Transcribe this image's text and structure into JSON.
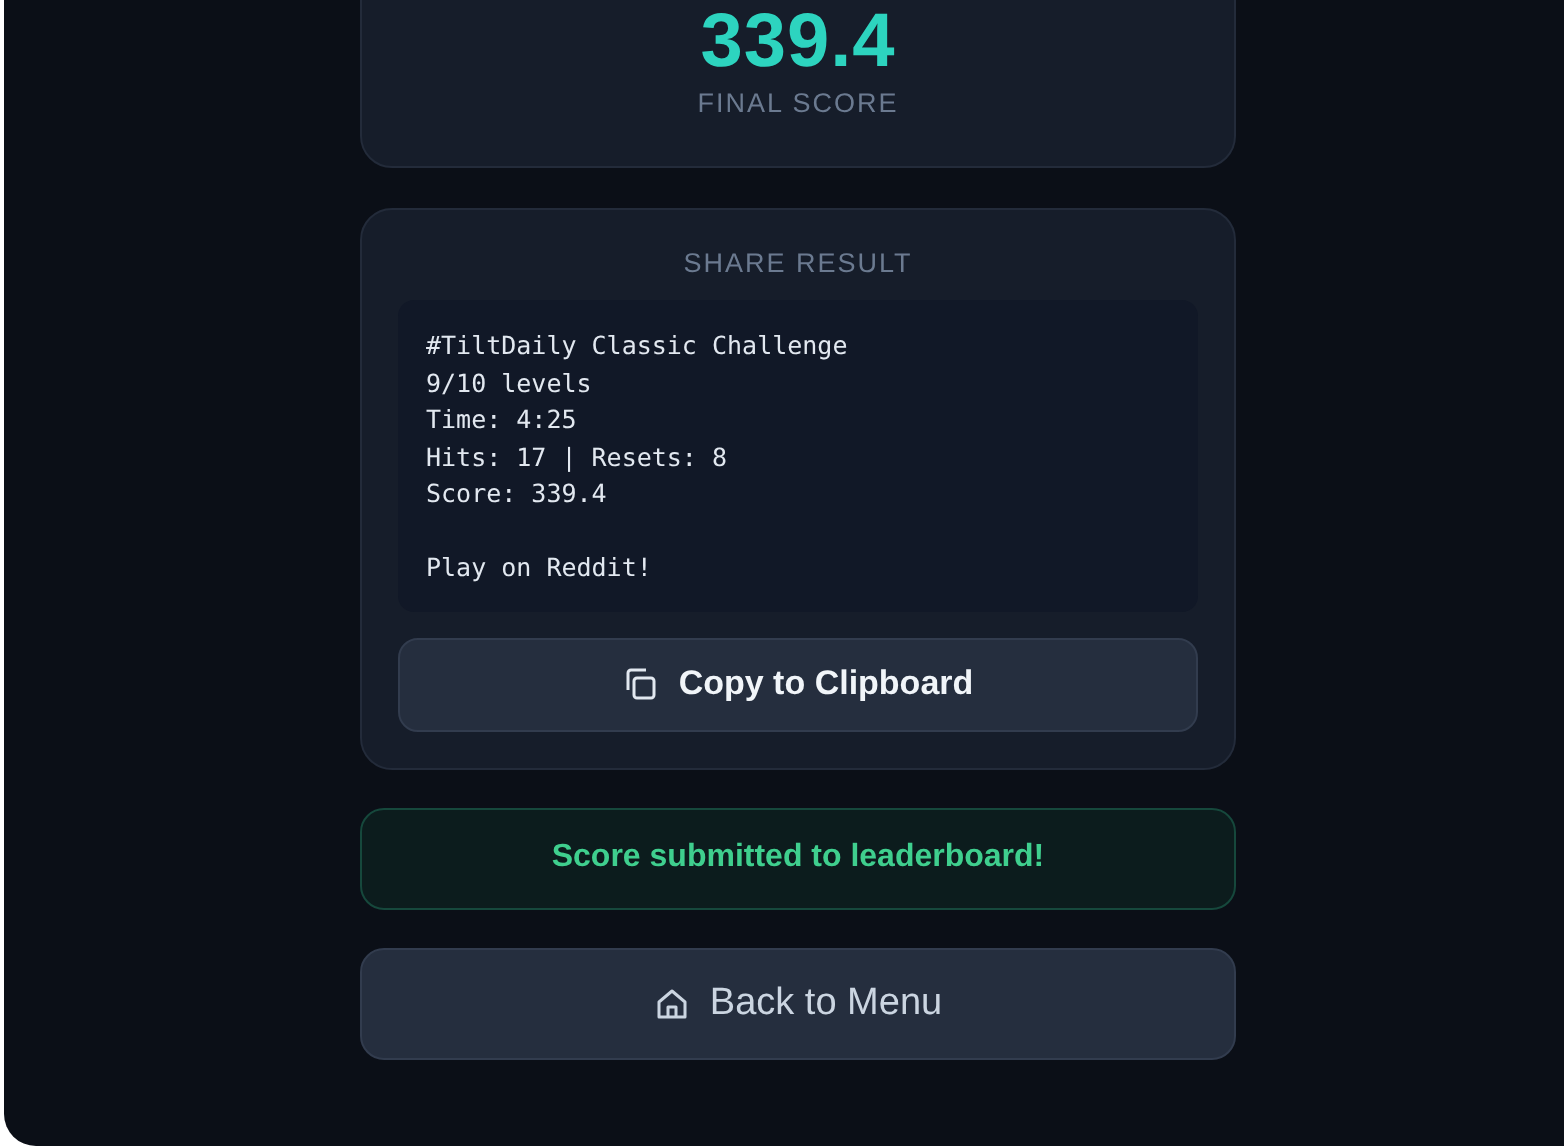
{
  "score": {
    "value": "339.4",
    "label": "FINAL SCORE"
  },
  "share": {
    "title": "SHARE RESULT",
    "text": "#TiltDaily Classic Challenge\n9/10 levels\nTime: 4:25\nHits: 17 | Resets: 8\nScore: 339.4\n\nPlay on Reddit!",
    "copy_button": "Copy to Clipboard"
  },
  "status": "Score submitted to leaderboard!",
  "back_button": "Back to Menu"
}
